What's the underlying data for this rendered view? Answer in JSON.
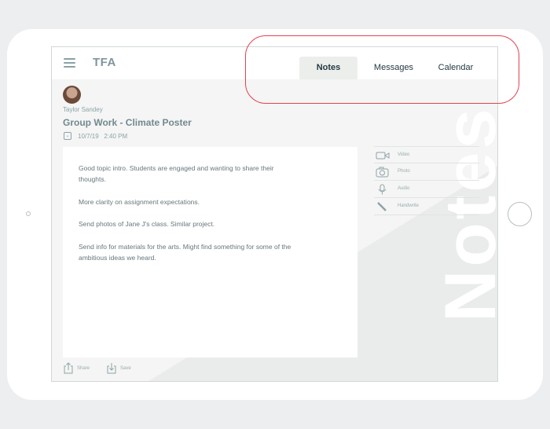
{
  "app": {
    "logo": "TFA"
  },
  "tabs": [
    {
      "label": "Notes",
      "active": true
    },
    {
      "label": "Messages",
      "active": false
    },
    {
      "label": "Calendar",
      "active": false
    }
  ],
  "watermark": "Notes",
  "note": {
    "author": "Taylor Sandey",
    "title": "Group Work - Climate Poster",
    "date": "10/7/19",
    "time": "2:40 PM",
    "paragraphs": [
      "Good topic intro. Students are engaged and wanting to share their thoughts.",
      "More clarity on assignment expectations.",
      "Send photos of Jane J's class. Similar project.",
      "Send info for materials for the arts. Might find something for some of the ambitious ideas we heard."
    ]
  },
  "media": [
    {
      "label": "Video",
      "icon": "video-camera-icon"
    },
    {
      "label": "Photo",
      "icon": "camera-icon"
    },
    {
      "label": "Audio",
      "icon": "microphone-icon"
    },
    {
      "label": "Handwrite",
      "icon": "pencil-icon"
    }
  ],
  "actions": {
    "share": "Share",
    "save": "Save"
  },
  "colors": {
    "accent": "#253a44",
    "muted": "#8ea3a8",
    "highlight": "#e0424f"
  }
}
